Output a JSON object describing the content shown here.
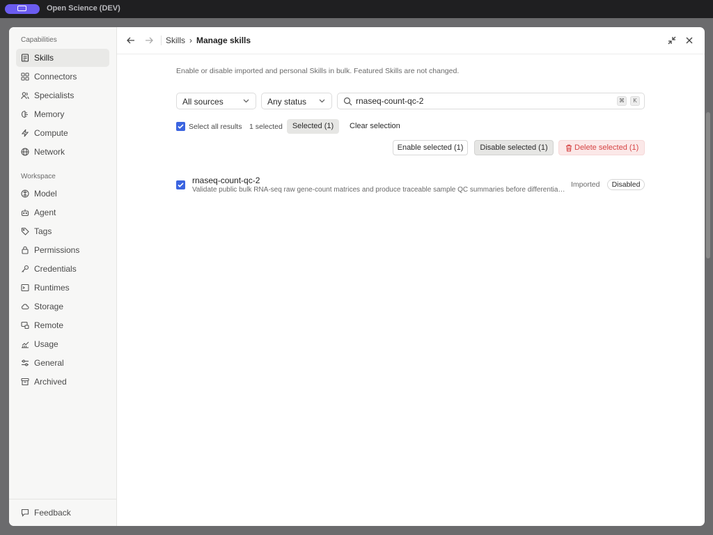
{
  "app": {
    "title": "Open Science (DEV)"
  },
  "sidebar": {
    "capabilities_title": "Capabilities",
    "capabilities": [
      {
        "label": "Skills",
        "icon": "skills-icon",
        "active": true
      },
      {
        "label": "Connectors",
        "icon": "connectors-icon"
      },
      {
        "label": "Specialists",
        "icon": "specialists-icon"
      },
      {
        "label": "Memory",
        "icon": "memory-icon"
      },
      {
        "label": "Compute",
        "icon": "compute-icon"
      },
      {
        "label": "Network",
        "icon": "network-icon"
      }
    ],
    "workspace_title": "Workspace",
    "workspace": [
      {
        "label": "Model",
        "icon": "model-icon"
      },
      {
        "label": "Agent",
        "icon": "agent-icon"
      },
      {
        "label": "Tags",
        "icon": "tags-icon"
      },
      {
        "label": "Permissions",
        "icon": "lock-icon"
      },
      {
        "label": "Credentials",
        "icon": "key-icon"
      },
      {
        "label": "Runtimes",
        "icon": "terminal-icon"
      },
      {
        "label": "Storage",
        "icon": "cloud-icon"
      },
      {
        "label": "Remote",
        "icon": "remote-icon"
      },
      {
        "label": "Usage",
        "icon": "usage-icon"
      },
      {
        "label": "General",
        "icon": "sliders-icon"
      },
      {
        "label": "Archived",
        "icon": "archive-icon"
      }
    ],
    "feedback_label": "Feedback"
  },
  "header": {
    "breadcrumb_parent": "Skills",
    "breadcrumb_separator": "›",
    "breadcrumb_current": "Manage skills"
  },
  "main": {
    "description": "Enable or disable imported and personal Skills in bulk. Featured Skills are not changed.",
    "source_filter": "All sources",
    "status_filter": "Any status",
    "search_value": "rnaseq-count-qc-2",
    "shortcut_keys": [
      "⌘",
      "K"
    ],
    "select_all_label": "Select all results",
    "selected_count": "1 selected",
    "selected_pill": "Selected (1)",
    "clear_selection": "Clear selection",
    "enable_selected": "Enable selected (1)",
    "disable_selected": "Disable selected (1)",
    "delete_selected": "Delete selected (1)",
    "accent_color": "#3b64e0",
    "danger_color": "#d64545",
    "skills": [
      {
        "name": "rnaseq-count-qc-2",
        "description": "Validate public bulk RNA-seq raw gene-count matrices and produce traceable sample QC summaries before differential expression analysis",
        "source": "Imported",
        "status": "Disabled",
        "checked": true
      }
    ]
  }
}
